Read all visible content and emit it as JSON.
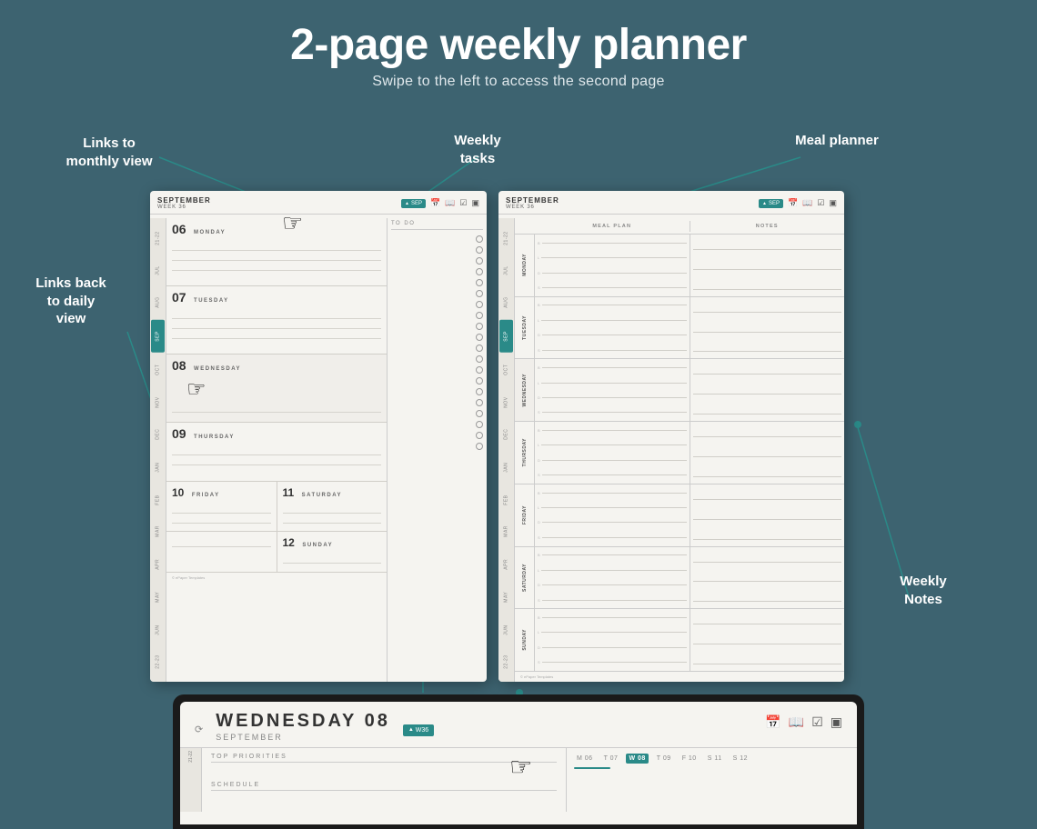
{
  "header": {
    "title": "2-page weekly planner",
    "subtitle": "Swipe to the left to access the second page"
  },
  "annotations": {
    "monthly": "Links to\nmonthly view",
    "weekly_tasks": "Weekly\ntasks",
    "meal_planner": "Meal planner",
    "daily": "Links back\nto daily\nview",
    "weekly_notes": "Weekly\nNotes"
  },
  "left_page": {
    "month": "SEPTEMBER",
    "week": "WEEK 36",
    "nav_btn": "SEP",
    "side_tabs": [
      "21-22",
      "JUL",
      "AUG",
      "SEP",
      "OCT",
      "NOV",
      "DEC",
      "JAN",
      "FEB",
      "MAR",
      "APR",
      "MAY",
      "JUN",
      "22-23"
    ],
    "days": [
      {
        "num": "06",
        "name": "MONDAY"
      },
      {
        "num": "07",
        "name": "TUESDAY"
      },
      {
        "num": "08",
        "name": "WEDNESDAY"
      },
      {
        "num": "09",
        "name": "THURSDAY"
      },
      {
        "num": "10",
        "name": "FRIDAY"
      },
      {
        "num": "11",
        "name": "SATURDAY"
      },
      {
        "num": "12",
        "name": "SUNDAY"
      }
    ],
    "todo_label": "TO DO"
  },
  "right_page": {
    "month": "SEPTEMBER",
    "week": "WEEK 36",
    "nav_btn": "SEP",
    "side_tabs": [
      "21-22",
      "JUL",
      "AUG",
      "SEP",
      "OCT",
      "NOV",
      "DEC",
      "JAN",
      "FEB",
      "MAR",
      "APR",
      "MAY",
      "JUN",
      "22-23"
    ],
    "meal_header": "MEAL PLAN",
    "notes_header": "NOTES",
    "days": [
      "MONDAY",
      "TUESDAY",
      "WEDNESDAY",
      "THURSDAY",
      "FRIDAY",
      "SATURDAY",
      "SUNDAY"
    ],
    "meal_labels": [
      "B",
      "L",
      "D",
      "S"
    ]
  },
  "device": {
    "day": "WEDNESDAY 08",
    "month": "SEPTEMBER",
    "week_badge": "W36",
    "section_label": "TOP PRIORITIES",
    "schedule_label": "SCHEDULE",
    "nav_days": [
      "M 06",
      "T 07",
      "W 08",
      "T 09",
      "F 10",
      "S 11",
      "S 12"
    ],
    "current_day_index": 2,
    "side_label": "21-22"
  },
  "colors": {
    "teal": "#2a8a88",
    "background": "#3d6370",
    "page_bg": "#f5f4f0",
    "line": "#d0cec8",
    "text_dark": "#333333",
    "text_muted": "#888888"
  }
}
